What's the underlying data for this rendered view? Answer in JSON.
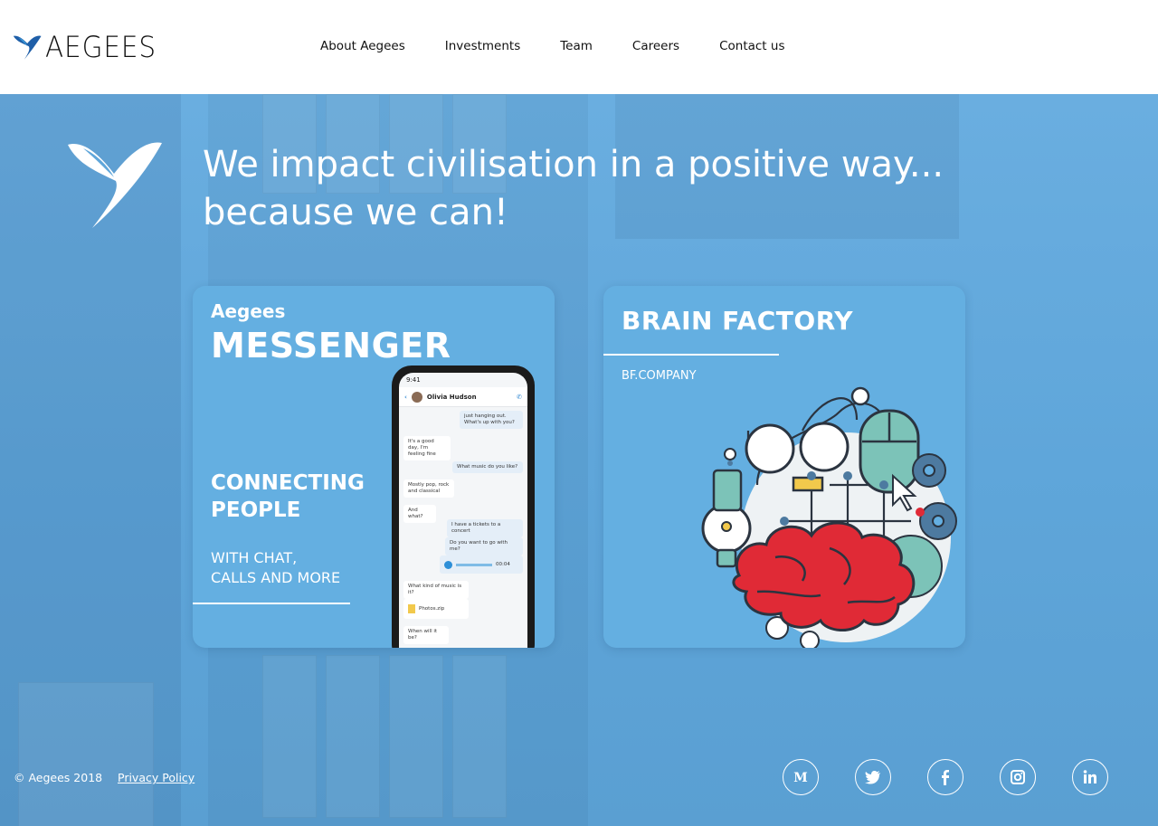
{
  "header": {
    "logo_text": "AEGEES",
    "nav": [
      {
        "label": "About Aegees"
      },
      {
        "label": "Investments"
      },
      {
        "label": "Team"
      },
      {
        "label": "Careers"
      },
      {
        "label": "Contact us"
      }
    ]
  },
  "hero": {
    "title_line1": "We impact civilisation in a positive way...",
    "title_line2": "because we can!"
  },
  "cards": {
    "messenger": {
      "small": "Aegees",
      "big": "MESSENGER",
      "connecting_line1": "CONNECTING",
      "connecting_line2": "PEOPLE",
      "with_line1": "WITH CHAT,",
      "with_line2": "CALLS AND MORE",
      "phone": {
        "time": "9:41",
        "contact": "Olivia Hudson",
        "messages": [
          "just hanging out. What's up with you?",
          "It's a good day, I'm feeling fine",
          "What music do you like?",
          "Mostly pop, rock and classical",
          "And what?",
          "I have a tickets to a concert",
          "Do you want to go with me?",
          "00:04",
          "What kind of music is it?",
          "Photos.zip",
          "When will it be?"
        ]
      }
    },
    "brain": {
      "title": "BRAIN FACTORY",
      "subtitle": "BF.COMPANY"
    }
  },
  "footer": {
    "copyright": "© Aegees 2018",
    "privacy": "Privacy Policy",
    "social": [
      {
        "icon": "medium-icon"
      },
      {
        "icon": "twitter-icon"
      },
      {
        "icon": "facebook-icon"
      },
      {
        "icon": "instagram-icon"
      },
      {
        "icon": "linkedin-icon"
      }
    ]
  },
  "colors": {
    "brand_blue": "#5ea3d6",
    "card_blue": "#64afe1",
    "brain_red": "#e02a36",
    "teal": "#7cc3b8"
  }
}
